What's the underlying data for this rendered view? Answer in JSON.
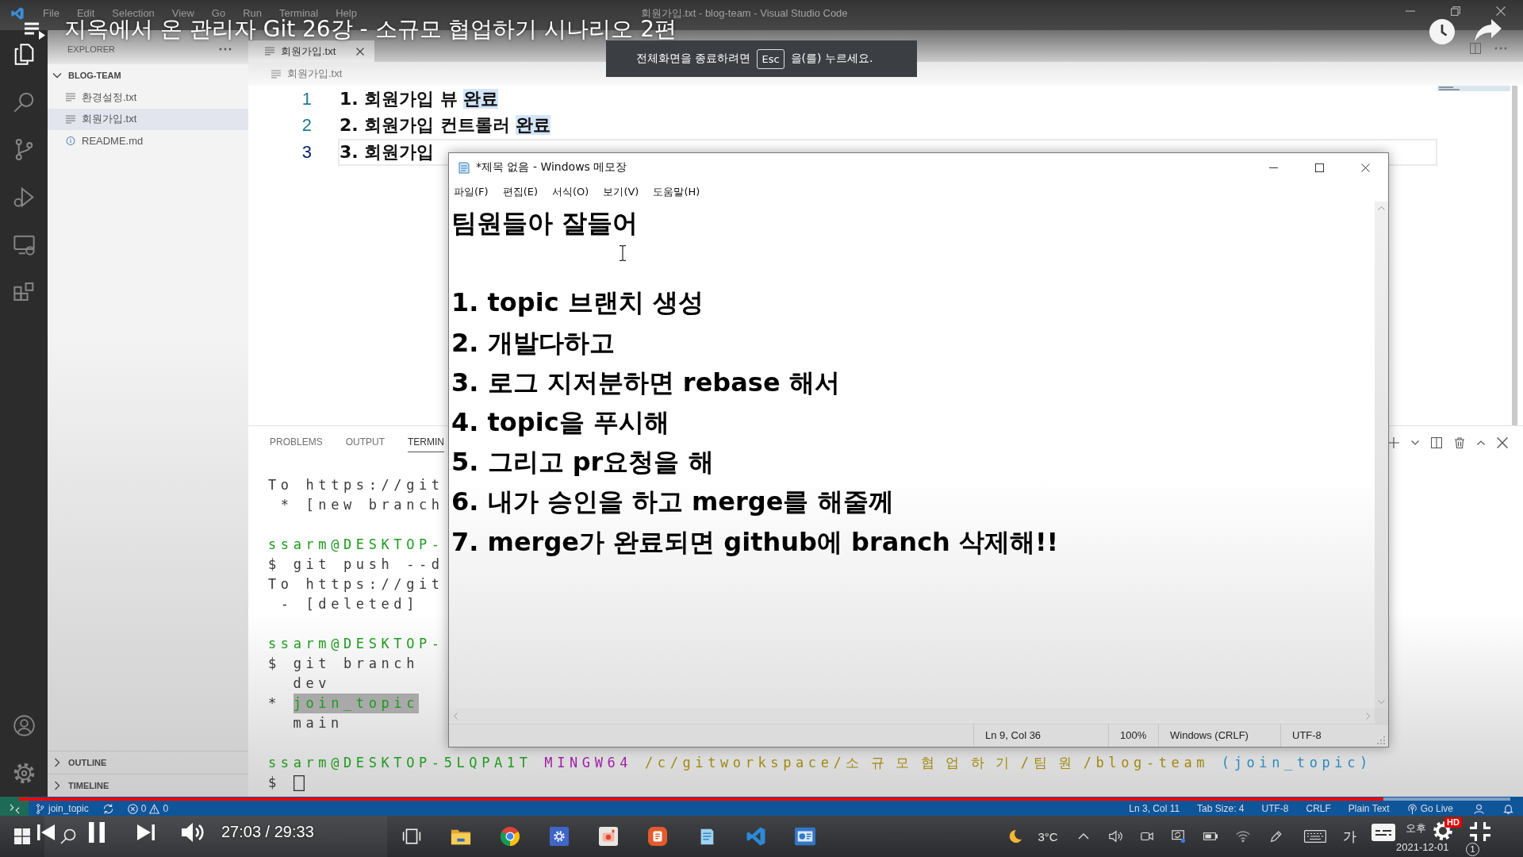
{
  "vscode": {
    "menu": [
      "File",
      "Edit",
      "Selection",
      "View",
      "Go",
      "Run",
      "Terminal",
      "Help"
    ],
    "title": "회원가입.txt - blog-team - Visual Studio Code",
    "activity_bar": [
      {
        "kind": "explorer",
        "selected": true
      },
      {
        "kind": "search",
        "selected": false
      },
      {
        "kind": "source_control",
        "selected": false
      },
      {
        "kind": "run",
        "selected": false
      },
      {
        "kind": "remote",
        "selected": false
      },
      {
        "kind": "extensions",
        "selected": false
      }
    ],
    "sidebar": {
      "title": "EXPLORER",
      "folder": {
        "name": "BLOG-TEAM",
        "expanded": true,
        "files": [
          {
            "name": "환경설정.txt",
            "kind": "text",
            "selected": false
          },
          {
            "name": "회원가입.txt",
            "kind": "text",
            "selected": true
          },
          {
            "name": "README.md",
            "kind": "info",
            "selected": false
          }
        ]
      },
      "sections": [
        {
          "label": "OUTLINE",
          "expanded": false
        },
        {
          "label": "TIMELINE",
          "expanded": false
        }
      ]
    },
    "editor": {
      "tabs": [
        {
          "label": "회원가입.txt",
          "selected": true
        }
      ],
      "breadcrumb": "회원가입.txt",
      "lines": [
        {
          "number": "1",
          "text": "1. 회원가입 뷰",
          "match": "완료",
          "current": false
        },
        {
          "number": "2",
          "text": "2. 회원가입 컨트롤러",
          "match": "완료",
          "current": false
        },
        {
          "number": "3",
          "text": "3. 회원가입",
          "current": true
        }
      ]
    },
    "panel": {
      "tabs": [
        {
          "label": "PROBLEMS",
          "selected": false
        },
        {
          "label": "OUTPUT",
          "selected": false
        },
        {
          "label": "TERMIN",
          "selected": true
        }
      ],
      "terminal": [
        {
          "kind": "output",
          "text": "To https://git"
        },
        {
          "kind": "output",
          "text": " * [new branch"
        },
        {
          "kind": "blank"
        },
        {
          "kind": "user",
          "text": "ssarm@DESKTOP-"
        },
        {
          "kind": "output",
          "text": "$ git push --d"
        },
        {
          "kind": "output",
          "text": "To https://git"
        },
        {
          "kind": "output",
          "text": " - [deleted]"
        },
        {
          "kind": "blank"
        },
        {
          "kind": "user",
          "text": "ssarm@DESKTOP-"
        },
        {
          "kind": "output",
          "text": "$ git branch"
        },
        {
          "kind": "branch",
          "name": "dev",
          "current": false
        },
        {
          "kind": "branch",
          "marker": "*",
          "name": "join_topic",
          "current": true
        },
        {
          "kind": "branch",
          "name": "main",
          "current": false
        },
        {
          "kind": "blank"
        },
        {
          "kind": "prompt",
          "user": "ssarm@DESKTOP-5LQPA1T",
          "shell": "MINGW64",
          "path": "/c/gitworkspace/소규모협업하기/팀원/blog-team",
          "branch": "(join_topic)"
        },
        {
          "kind": "input",
          "prompt": "$"
        }
      ]
    },
    "status_bar": {
      "branch": "join_topic",
      "errors": "0",
      "warnings": "0",
      "items": [
        "Ln 3, Col 11",
        "Tab Size: 4",
        "UTF-8",
        "CRLF",
        "Plain Text"
      ],
      "go_live": "Go Live"
    }
  },
  "notepad": {
    "title": "*제목 없음 - Windows 메모장",
    "menu": [
      "파일(F)",
      "편집(E)",
      "서식(O)",
      "보기(V)",
      "도움말(H)"
    ],
    "heading": "팀원들아 잘들어",
    "items": [
      "1. topic 브랜치 생성",
      "2. 개발다하고",
      "3. 로그 지저분하면 rebase 해서",
      "4. topic을 푸시해",
      "5. 그리고 pr요청을 해",
      "6. 내가 승인을 하고 merge를 해줄께",
      "7. merge가 완료되면 github에 branch 삭제해!!"
    ],
    "status": [
      "Ln 9, Col 36",
      "100%",
      "Windows (CRLF)",
      "UTF-8"
    ]
  },
  "video_player": {
    "title": "지옥에서 온 관리자 Git 26강 - 소규모 협업하기 시나리오 2편",
    "toast": {
      "before": "전체화면을 종료하려면",
      "key": "Esc",
      "after": "을(를) 누르세요."
    },
    "progress": {
      "level": 0.915
    },
    "time": "27:03 / 29:33",
    "quality_badge": "HD"
  },
  "taskbar": {
    "weather": "3°C",
    "input_method": "가",
    "clock": {
      "time": "오후",
      "date": "2021-12-01"
    },
    "notification_count": "1"
  }
}
